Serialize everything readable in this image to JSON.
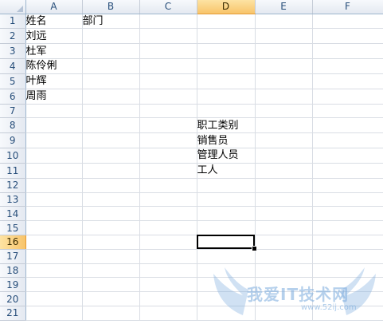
{
  "sheet": {
    "columns": [
      "A",
      "B",
      "C",
      "D",
      "E",
      "F"
    ],
    "selected_column": "D",
    "rows": [
      "1",
      "2",
      "3",
      "4",
      "5",
      "6",
      "7",
      "8",
      "9",
      "10",
      "11",
      "12",
      "13",
      "14",
      "15",
      "16",
      "17",
      "18",
      "19",
      "20",
      "21"
    ],
    "selected_row": "16",
    "active_cell": "D16",
    "cells": {
      "A1": "姓名",
      "B1": "部门",
      "A2": "刘远",
      "A3": "杜军",
      "A4": "陈伶俐",
      "A5": "叶辉",
      "A6": "周雨",
      "D8": "职工类别",
      "D9": "销售员",
      "D10": "管理人员",
      "D11": "工人"
    }
  },
  "watermark": {
    "text": "我爱IT技术网",
    "url": "www.52ij.com",
    "color": "#78aadc"
  },
  "colors": {
    "selection_header": "#f8c46a",
    "header_text": "#274e7a",
    "grid_line": "#d9dde4"
  }
}
